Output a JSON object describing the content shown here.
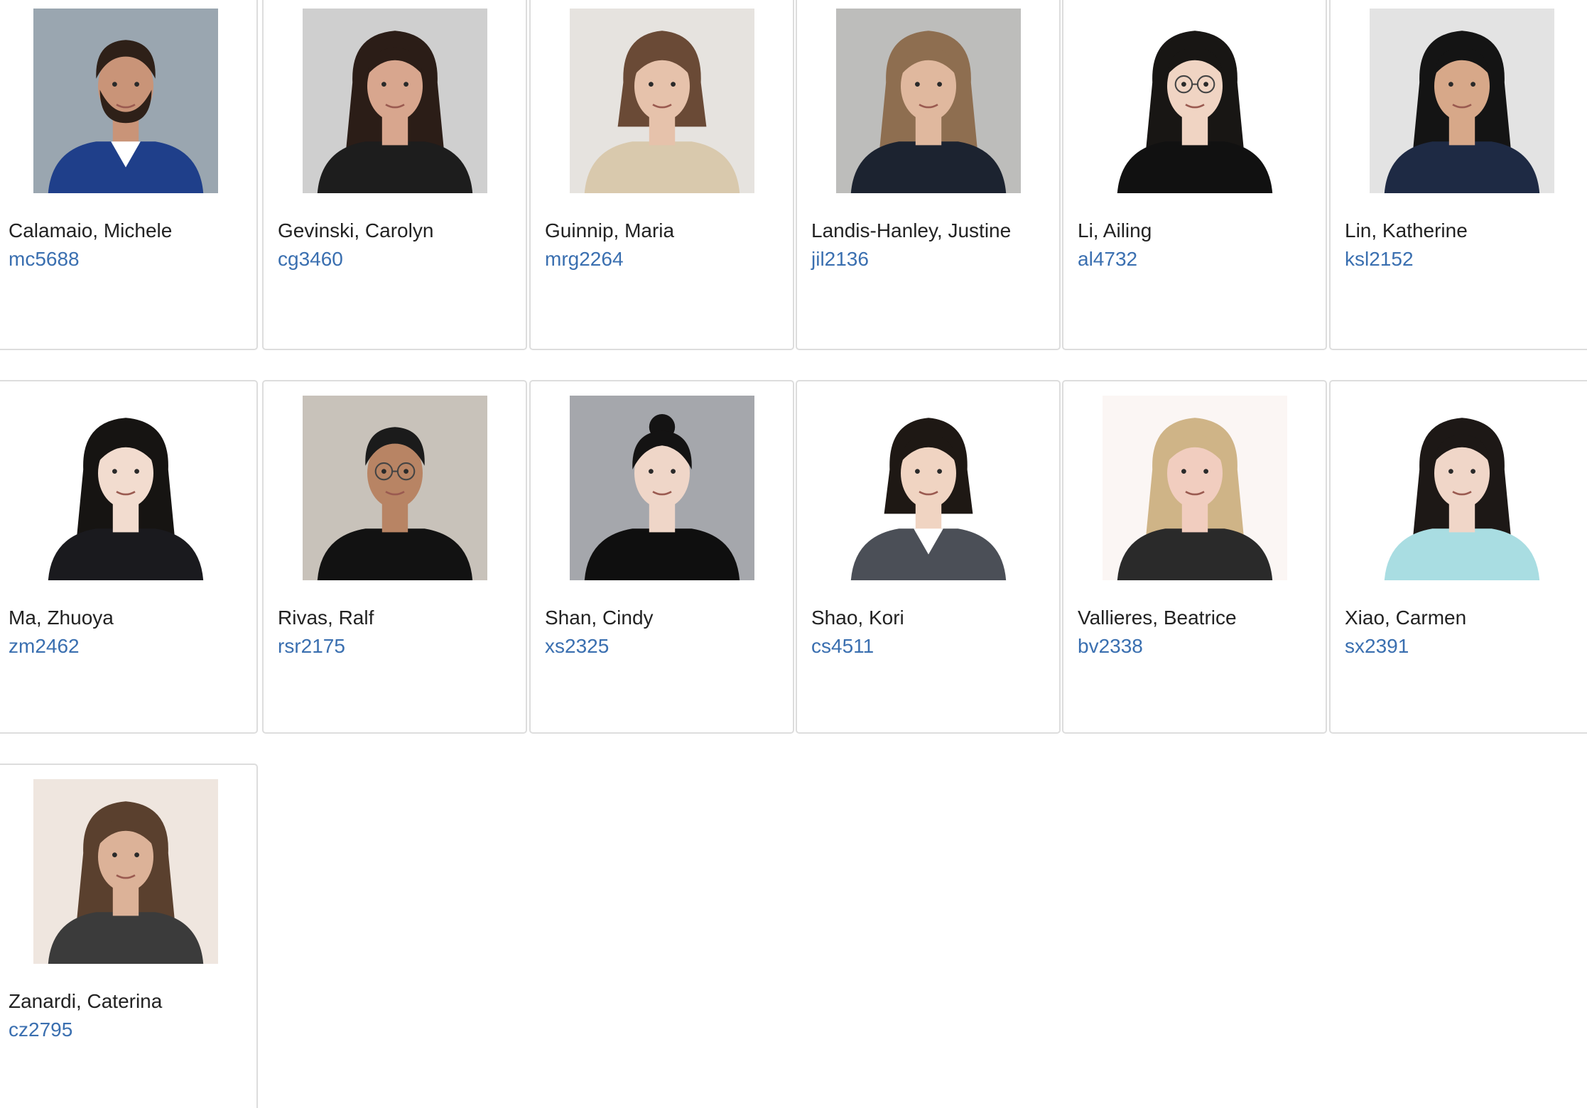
{
  "roster": {
    "students": [
      {
        "name": "Calamaio, Michele",
        "uni": "mc5688",
        "photo": {
          "bg": "#9aa6b0",
          "hair": "#2e2018",
          "skin": "#c99478",
          "outfit": "#1f3f8a",
          "hair_style": "short",
          "beard": true,
          "glasses": false,
          "collar": "#ffffff"
        }
      },
      {
        "name": "Gevinski, Carolyn",
        "uni": "cg3460",
        "photo": {
          "bg": "#cfcfcf",
          "hair": "#2b1d17",
          "skin": "#d8a68e",
          "outfit": "#1d1d1d",
          "hair_style": "long",
          "beard": false,
          "glasses": false,
          "collar": ""
        }
      },
      {
        "name": "Guinnip, Maria",
        "uni": "mrg2264",
        "photo": {
          "bg": "#e6e3df",
          "hair": "#6a4a36",
          "skin": "#e6c2ab",
          "outfit": "#d9c9ad",
          "hair_style": "bob",
          "beard": false,
          "glasses": false,
          "collar": ""
        }
      },
      {
        "name": "Landis-Hanley, Justine",
        "uni": "jil2136",
        "photo": {
          "bg": "#bdbdbb",
          "hair": "#8e6e50",
          "skin": "#e0b89e",
          "outfit": "#1c2330",
          "hair_style": "long",
          "beard": false,
          "glasses": false,
          "collar": ""
        }
      },
      {
        "name": "Li, Ailing",
        "uni": "al4732",
        "photo": {
          "bg": "#ffffff",
          "hair": "#181614",
          "skin": "#f0d4c3",
          "outfit": "#111111",
          "hair_style": "long",
          "beard": false,
          "glasses": true,
          "collar": ""
        }
      },
      {
        "name": "Lin, Katherine",
        "uni": "ksl2152",
        "photo": {
          "bg": "#e3e3e3",
          "hair": "#141414",
          "skin": "#d7a889",
          "outfit": "#1e2a44",
          "hair_style": "long",
          "beard": false,
          "glasses": false,
          "collar": ""
        }
      },
      {
        "name": "Ma, Zhuoya",
        "uni": "zm2462",
        "photo": {
          "bg": "#ffffff",
          "hair": "#161412",
          "skin": "#f2dccf",
          "outfit": "#1a1a1e",
          "hair_style": "long",
          "beard": false,
          "glasses": false,
          "collar": ""
        }
      },
      {
        "name": "Rivas, Ralf",
        "uni": "rsr2175",
        "photo": {
          "bg": "#c8c2ba",
          "hair": "#1b1b1b",
          "skin": "#b88464",
          "outfit": "#121212",
          "hair_style": "short",
          "beard": false,
          "glasses": true,
          "collar": ""
        }
      },
      {
        "name": "Shan, Cindy",
        "uni": "xs2325",
        "photo": {
          "bg": "#a5a7ac",
          "hair": "#141313",
          "skin": "#efd6c8",
          "outfit": "#0f0f0f",
          "hair_style": "bun",
          "beard": false,
          "glasses": false,
          "collar": ""
        }
      },
      {
        "name": "Shao, Kori",
        "uni": "cs4511",
        "photo": {
          "bg": "#ffffff",
          "hair": "#1e1814",
          "skin": "#f0d4c2",
          "outfit": "#4b4f57",
          "hair_style": "bob",
          "beard": false,
          "glasses": false,
          "collar": "#ffffff"
        }
      },
      {
        "name": "Vallieres, Beatrice",
        "uni": "bv2338",
        "photo": {
          "bg": "#fbf6f4",
          "hair": "#cfb487",
          "skin": "#f1cdbf",
          "outfit": "#2a2a2a",
          "hair_style": "long",
          "beard": false,
          "glasses": false,
          "collar": ""
        }
      },
      {
        "name": "Xiao, Carmen",
        "uni": "sx2391",
        "photo": {
          "bg": "#ffffff",
          "hair": "#1d1816",
          "skin": "#f0d6c8",
          "outfit": "#a9dde2",
          "hair_style": "long",
          "beard": false,
          "glasses": false,
          "collar": ""
        }
      },
      {
        "name": "Zanardi, Caterina",
        "uni": "cz2795",
        "photo": {
          "bg": "#efe6df",
          "hair": "#5a402e",
          "skin": "#dcb298",
          "outfit": "#3b3b3b",
          "hair_style": "long",
          "beard": false,
          "glasses": false,
          "collar": ""
        }
      }
    ]
  }
}
